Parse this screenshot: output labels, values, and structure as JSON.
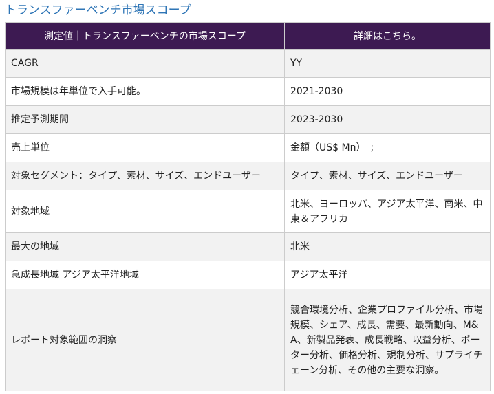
{
  "page": {
    "title": "トランスファーベンチ市場スコープ"
  },
  "table": {
    "headers": [
      "測定値｜トランスファーベンチの市場スコープ",
      "詳細はこちら。"
    ],
    "rows": [
      {
        "label": "CAGR",
        "value": "YY"
      },
      {
        "label": "市場規模は年単位で入手可能。",
        "value": "2021-2030"
      },
      {
        "label": "推定予測期間",
        "value": "2023-2030"
      },
      {
        "label": "売上単位",
        "value": "金額（US$ Mn）　;"
      },
      {
        "label": "対象セグメント：タイプ、素材、サイズ、エンドユーザー",
        "value": "タイプ、素材、サイズ、エンドユーザー"
      },
      {
        "label": "対象地域",
        "value": "北米、ヨーロッパ、アジア太平洋、南米、中東＆アフリカ"
      },
      {
        "label": "最大の地域",
        "value": "北米"
      },
      {
        "label": "急成長地域 アジア太平洋地域",
        "value": "アジア太平洋"
      },
      {
        "label": "レポート対象範囲の洞察",
        "value": "競合環境分析、企業プロファイル分析、市場規模、シェア、成長、需要、最新動向、M&A、新製品発表、成長戦略、収益分析、ポーター分析、価格分析、規制分析、サプライチェーン分析、その他の主要な洞察。"
      }
    ]
  },
  "colors": {
    "header_bg": "#3d1a52",
    "title": "#2e75b6",
    "row_alt": "#f2f2f2",
    "border": "#cccccc"
  }
}
